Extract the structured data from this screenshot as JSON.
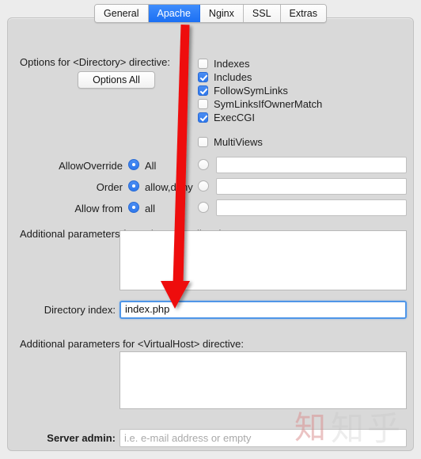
{
  "tabs": [
    {
      "label": "General",
      "active": false
    },
    {
      "label": "Apache",
      "active": true
    },
    {
      "label": "Nginx",
      "active": false
    },
    {
      "label": "SSL",
      "active": false
    },
    {
      "label": "Extras",
      "active": false
    }
  ],
  "directory_options": {
    "label": "Options for <Directory> directive:",
    "button_label": "Options All",
    "checkboxes": [
      {
        "label": "Indexes",
        "checked": false
      },
      {
        "label": "Includes",
        "checked": true
      },
      {
        "label": "FollowSymLinks",
        "checked": true
      },
      {
        "label": "SymLinksIfOwnerMatch",
        "checked": false
      },
      {
        "label": "ExecCGI",
        "checked": true
      },
      {
        "label": "MultiViews",
        "checked": false
      }
    ]
  },
  "radio_rows": [
    {
      "label": "AllowOverride",
      "preset_value": "All",
      "preset_selected": true,
      "custom_selected": false,
      "custom_value": ""
    },
    {
      "label": "Order",
      "preset_value": "allow,deny",
      "preset_selected": true,
      "custom_selected": false,
      "custom_value": ""
    },
    {
      "label": "Allow from",
      "preset_value": "all",
      "preset_selected": true,
      "custom_selected": false,
      "custom_value": ""
    }
  ],
  "directory_extra": {
    "label": "Additional parameters for <Directory> directive:",
    "value": ""
  },
  "directory_index": {
    "label": "Directory index:",
    "value": "index.php",
    "focused": true
  },
  "virtualhost_extra": {
    "label": "Additional parameters for <VirtualHost> directive:",
    "value": ""
  },
  "server_admin": {
    "label": "Server admin:",
    "value": "",
    "placeholder": "i.e. e-mail address or empty"
  },
  "annotation": {
    "arrow_color": "#ee1111",
    "arrow_from": "Apache tab",
    "arrow_to": "Directory index field"
  },
  "watermark": {
    "seal": "知",
    "text": "知乎"
  },
  "colors": {
    "accent_blue": "#2f78ec",
    "panel_bg": "#d9d9d9",
    "window_bg": "#ececec",
    "focus_border": "#4f96e8"
  }
}
